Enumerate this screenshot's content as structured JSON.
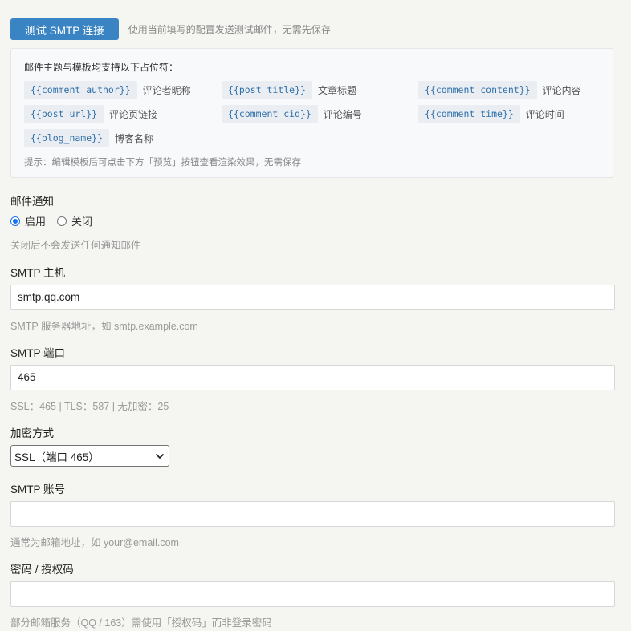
{
  "test": {
    "button_label": "测试 SMTP 连接",
    "hint": "使用当前填写的配置发送测试邮件，无需先保存"
  },
  "placeholders": {
    "title": "邮件主题与模板均支持以下占位符：",
    "items": [
      {
        "code": "{{comment_author}}",
        "desc": "评论者昵称"
      },
      {
        "code": "{{post_title}}",
        "desc": "文章标题"
      },
      {
        "code": "{{comment_content}}",
        "desc": "评论内容"
      },
      {
        "code": "{{post_url}}",
        "desc": "评论页链接"
      },
      {
        "code": "{{comment_cid}}",
        "desc": "评论编号"
      },
      {
        "code": "{{comment_time}}",
        "desc": "评论时间"
      },
      {
        "code": "{{blog_name}}",
        "desc": "博客名称"
      }
    ],
    "tip": "提示：编辑模板后可点击下方「预览」按钮查看渲染效果，无需保存"
  },
  "notify": {
    "label": "邮件通知",
    "options": [
      {
        "label": "启用",
        "checked": true
      },
      {
        "label": "关闭",
        "checked": false
      }
    ],
    "help": "关闭后不会发送任何通知邮件"
  },
  "host": {
    "label": "SMTP 主机",
    "value": "smtp.qq.com",
    "help": "SMTP 服务器地址，如 smtp.example.com"
  },
  "port": {
    "label": "SMTP 端口",
    "value": "465",
    "help": "SSL：465 | TLS：587 | 无加密：25"
  },
  "encryption": {
    "label": "加密方式",
    "selected": "SSL（端口 465）"
  },
  "account": {
    "label": "SMTP 账号",
    "value": "",
    "help": "通常为邮箱地址，如 your@email.com"
  },
  "password": {
    "label": "密码 / 授权码",
    "value": "",
    "help": "部分邮箱服务（QQ / 163）需使用「授权码」而非登录密码"
  }
}
